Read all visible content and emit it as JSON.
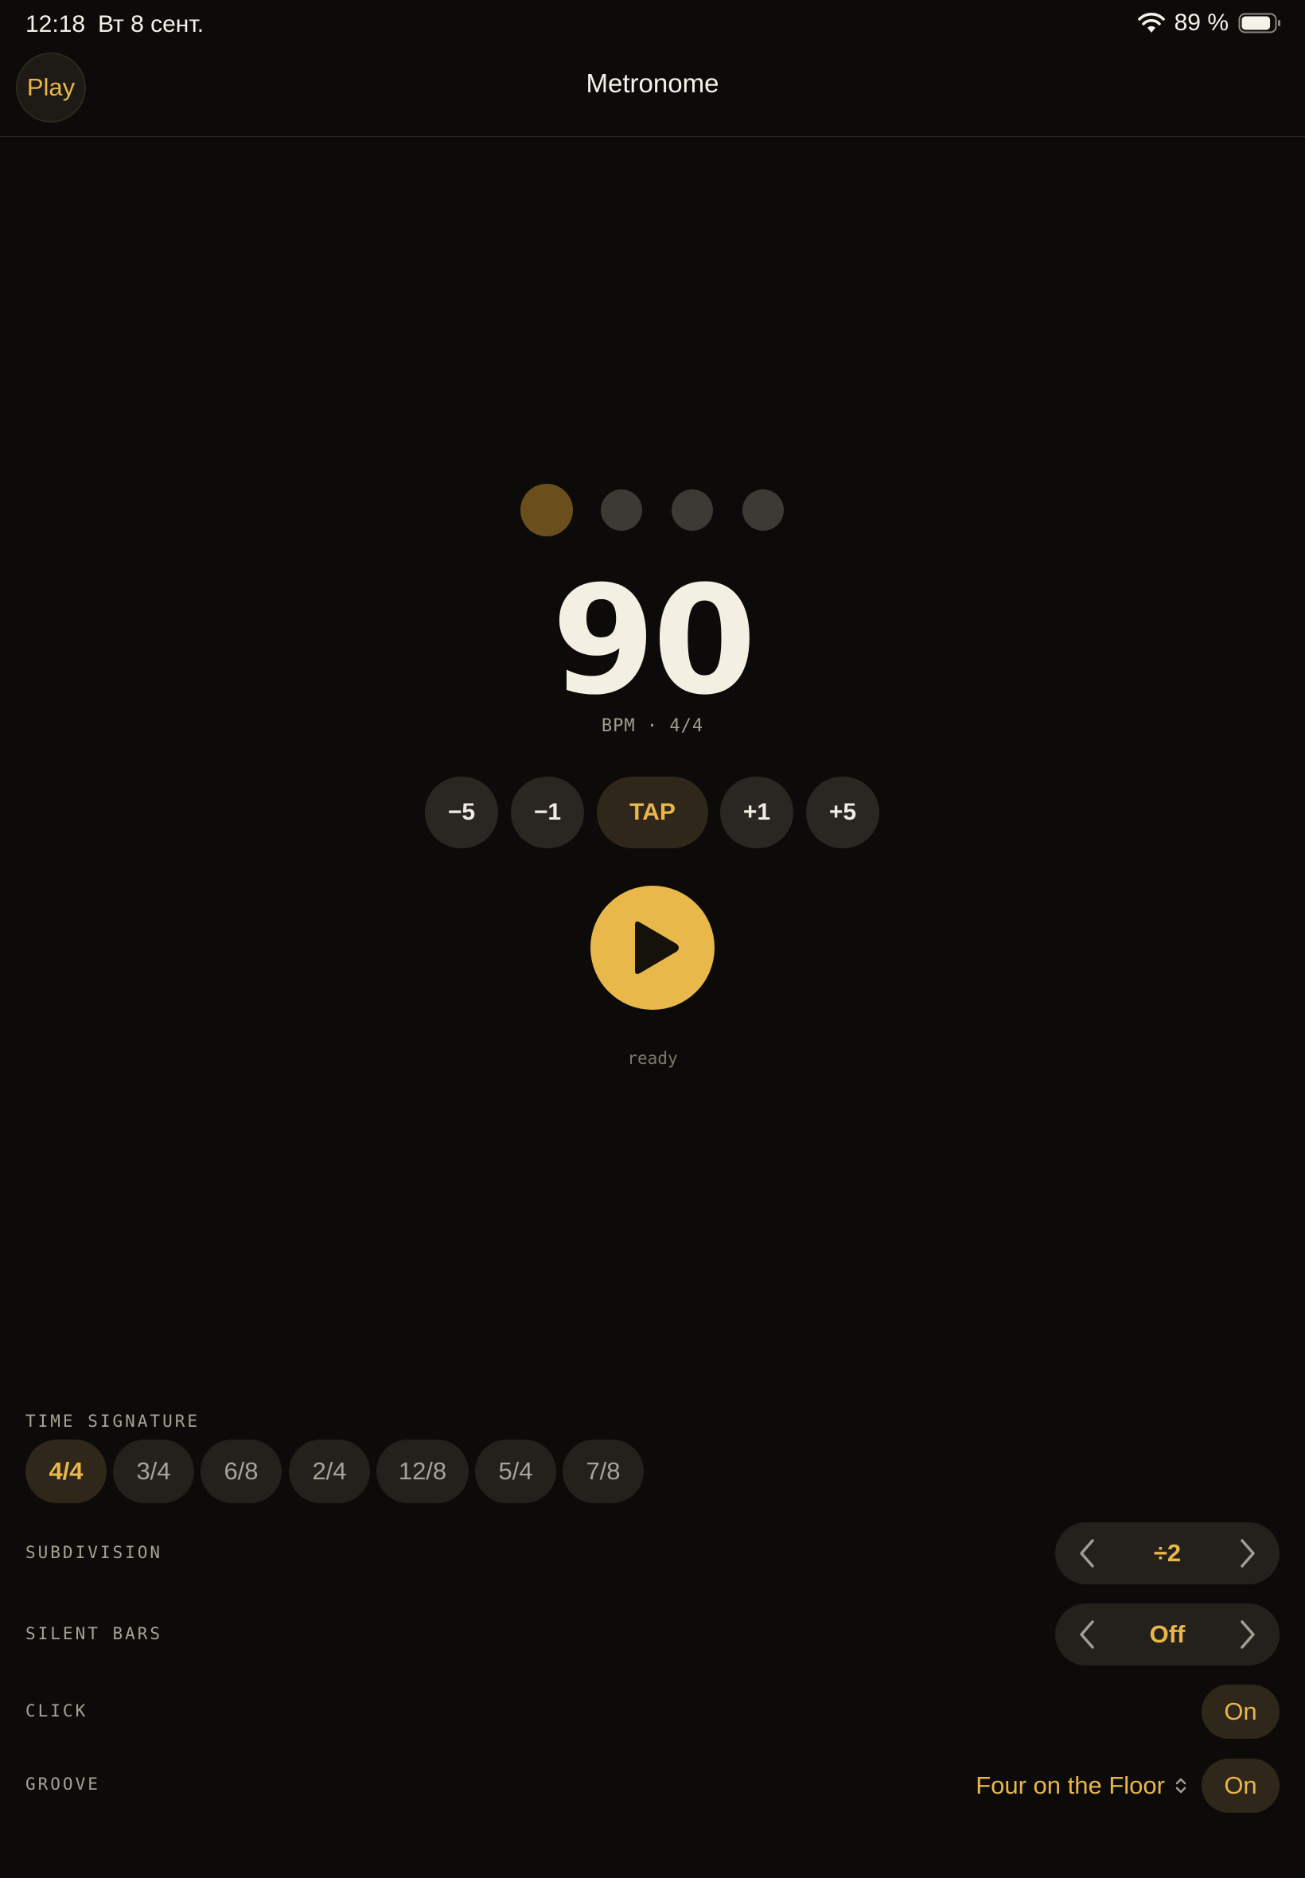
{
  "status_bar": {
    "time": "12:18",
    "date": "Вт 8 сент.",
    "battery_percent": "89 %",
    "battery_level": 0.89,
    "icons": [
      "wifi-icon",
      "battery-icon"
    ]
  },
  "nav": {
    "play_label": "Play",
    "title": "Metronome"
  },
  "beats": {
    "count": 4,
    "active_index": 0
  },
  "tempo": {
    "bpm": "90",
    "caption": "BPM · 4/4"
  },
  "adjust": {
    "minus5": "−5",
    "minus1": "−1",
    "tap": "TAP",
    "plus1": "+1",
    "plus5": "+5"
  },
  "transport": {
    "play_icon": "play-icon",
    "state": "ready"
  },
  "time_signature": {
    "label": "TIME SIGNATURE",
    "options": [
      "4/4",
      "3/4",
      "6/8",
      "2/4",
      "12/8",
      "5/4",
      "7/8"
    ],
    "selected": "4/4"
  },
  "subdivision": {
    "label": "SUBDIVISION",
    "value": "÷2"
  },
  "silent_bars": {
    "label": "SILENT BARS",
    "value": "Off"
  },
  "click": {
    "label": "CLICK",
    "value": "On"
  },
  "groove": {
    "label": "GROOVE",
    "pattern": "Four on the Floor",
    "value": "On"
  },
  "colors": {
    "background": "#0d0b09",
    "accent": "#e8b84a",
    "chip": "#24211d",
    "chip_active": "#2f2719"
  }
}
